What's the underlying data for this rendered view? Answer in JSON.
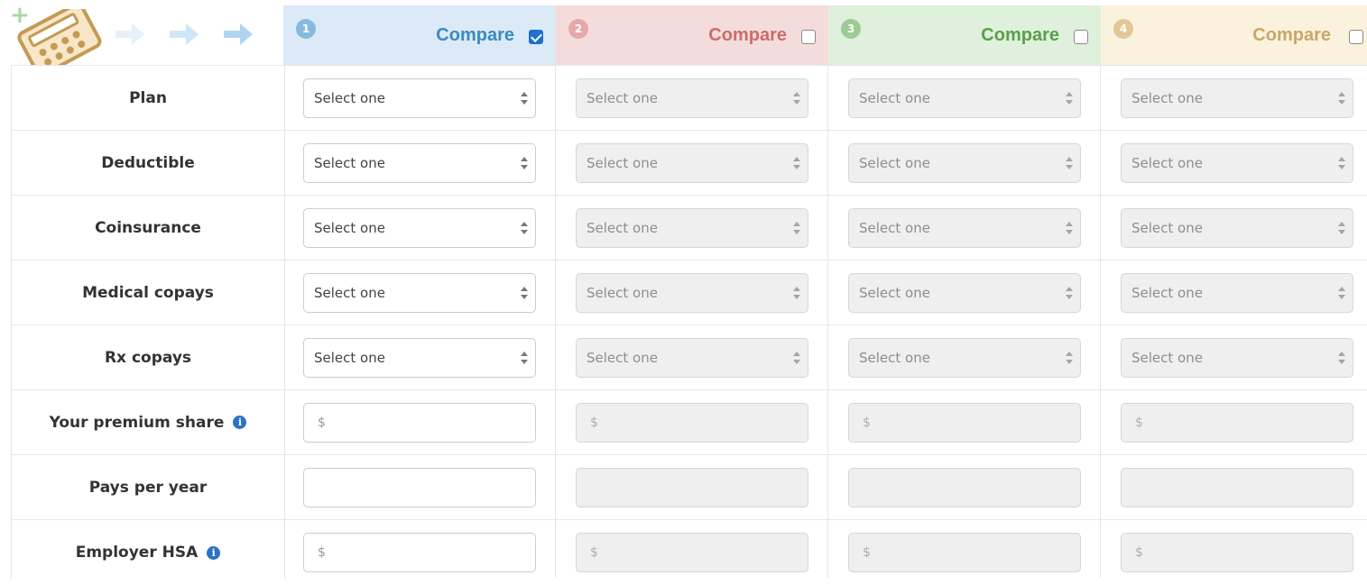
{
  "logo": {
    "plus_glyph": "+",
    "icon": "calculator-icon",
    "arrows_icon": "arrow-right-icon"
  },
  "colors": {
    "plan1": "#3a8ac3",
    "plan2": "#cf6b6b",
    "plan3": "#5a9f4e",
    "plan4": "#c9a768",
    "plan1_bg": "#dbeaf6",
    "plan2_bg": "#f4dcdc",
    "plan3_bg": "#dff0dc",
    "plan4_bg": "#fbf2de",
    "checkbox_checked": "#1f6fd1",
    "info_icon": "#2c72c9"
  },
  "plans": [
    {
      "number": "1",
      "compare_label": "Compare",
      "compare_checked": true
    },
    {
      "number": "2",
      "compare_label": "Compare",
      "compare_checked": false
    },
    {
      "number": "3",
      "compare_label": "Compare",
      "compare_checked": false
    },
    {
      "number": "4",
      "compare_label": "Compare",
      "compare_checked": false
    }
  ],
  "rows": [
    {
      "label": "Plan",
      "type": "select",
      "value": "Select one"
    },
    {
      "label": "Deductible",
      "type": "select",
      "value": "Select one"
    },
    {
      "label": "Coinsurance",
      "type": "select",
      "value": "Select one"
    },
    {
      "label": "Medical copays",
      "type": "select",
      "value": "Select one"
    },
    {
      "label": "Rx copays",
      "type": "select",
      "value": "Select one"
    },
    {
      "label": "Your premium share",
      "type": "currency",
      "placeholder": "$",
      "info": true,
      "info_glyph": "i"
    },
    {
      "label": "Pays per year",
      "type": "text",
      "placeholder": ""
    },
    {
      "label": "Employer HSA",
      "type": "currency",
      "placeholder": "$",
      "info": true,
      "info_glyph": "i"
    }
  ]
}
